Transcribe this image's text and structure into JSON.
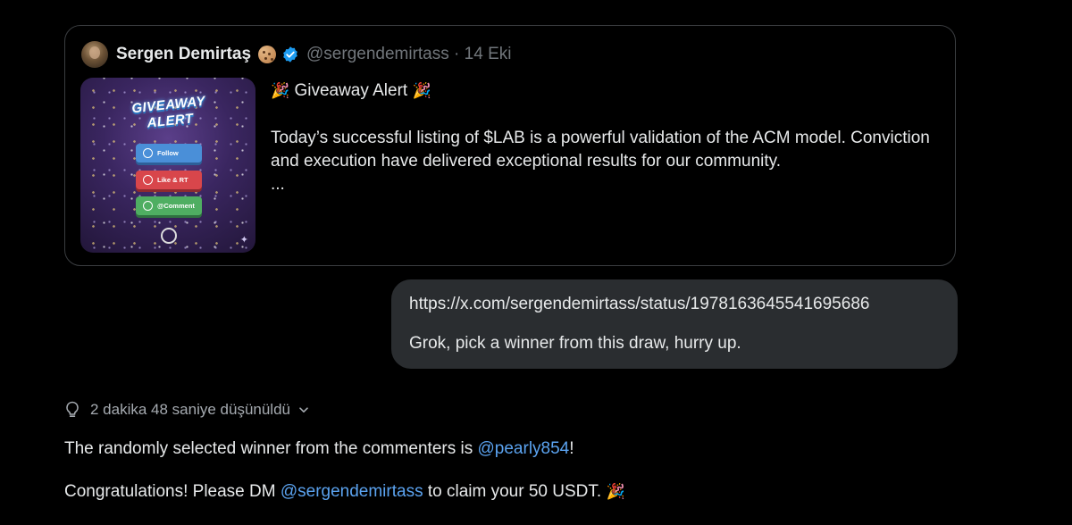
{
  "quote": {
    "author_name": "Sergen Demirtaş",
    "handle": "@sergendemirtass",
    "separator": "·",
    "date": "14 Eki",
    "title_text": "Giveaway Alert",
    "body": "Today’s successful listing of $LAB is a powerful validation of the ACM model. Conviction and execution have delivered exceptional results for our community.",
    "ellipsis": "...",
    "image": {
      "banner_line1": "GIVEAWAY",
      "banner_line2": "ALERT",
      "buttons": [
        "Follow",
        "Like & RT",
        "@Comment"
      ]
    }
  },
  "user_message": {
    "link": "https://x.com/sergendemirtass/status/1978163645541695686",
    "text": "Grok, pick a winner from this draw, hurry up."
  },
  "thinking": {
    "label": "2 dakika 48 saniye düşünüldü"
  },
  "reply": {
    "p1_before": "The randomly selected winner from the commenters is ",
    "p1_mention": "@pearly854",
    "p1_after": "!",
    "p2_before": "Congratulations! Please DM ",
    "p2_mention": "@sergendemirtass",
    "p2_after": " to claim your 50 USDT.",
    "emoji": "🎉"
  },
  "colors": {
    "background": "#000000",
    "text": "#e7e9ea",
    "muted": "#71767b",
    "link": "#5ba3f0",
    "bubble": "#2a2d30",
    "verified": "#1d9bf0"
  },
  "icons": [
    "avatar",
    "cookie-emoji-icon",
    "verified-badge-icon",
    "party-popper-icon",
    "lightbulb-icon",
    "chevron-down-icon"
  ]
}
